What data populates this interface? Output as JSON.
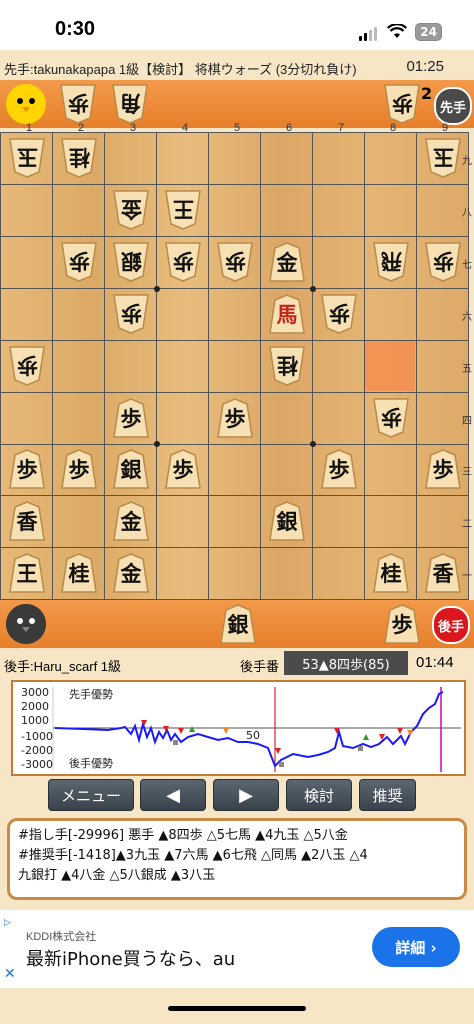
{
  "status": {
    "time": "0:30",
    "battery": "24"
  },
  "header": {
    "text": "先手:takunakapapa 1級【検討】 将棋ウォーズ (3分切れ負け)",
    "clock": "01:25"
  },
  "top_hand": {
    "pieces": [
      "歩",
      "角"
    ],
    "right_piece": "歩",
    "right_count": "2",
    "badge": "先手"
  },
  "bottom_hand": {
    "pieces": [
      "銀",
      "歩"
    ],
    "badge": "後手"
  },
  "board": {
    "col_labels": [
      "1",
      "2",
      "3",
      "4",
      "5",
      "6",
      "7",
      "8",
      "9"
    ],
    "row_labels": [
      "九",
      "八",
      "七",
      "六",
      "五",
      "四",
      "三",
      "二",
      "一"
    ],
    "pieces": [
      {
        "c": 0,
        "r": 0,
        "k": "玉",
        "g": true
      },
      {
        "c": 1,
        "r": 0,
        "k": "桂",
        "g": true
      },
      {
        "c": 8,
        "r": 0,
        "k": "玉",
        "g": true
      },
      {
        "c": 2,
        "r": 1,
        "k": "金",
        "g": true
      },
      {
        "c": 3,
        "r": 1,
        "k": "王",
        "g": true
      },
      {
        "c": 1,
        "r": 2,
        "k": "歩",
        "g": true
      },
      {
        "c": 2,
        "r": 2,
        "k": "銀",
        "g": true
      },
      {
        "c": 3,
        "r": 2,
        "k": "歩",
        "g": true
      },
      {
        "c": 4,
        "r": 2,
        "k": "歩",
        "g": true
      },
      {
        "c": 5,
        "r": 2,
        "k": "金",
        "g": false
      },
      {
        "c": 7,
        "r": 2,
        "k": "飛",
        "g": true
      },
      {
        "c": 8,
        "r": 2,
        "k": "歩",
        "g": true
      },
      {
        "c": 2,
        "r": 3,
        "k": "歩",
        "g": true
      },
      {
        "c": 5,
        "r": 3,
        "k": "馬",
        "g": false,
        "p": true
      },
      {
        "c": 6,
        "r": 3,
        "k": "歩",
        "g": true
      },
      {
        "c": 0,
        "r": 4,
        "k": "歩",
        "g": true
      },
      {
        "c": 5,
        "r": 4,
        "k": "桂",
        "g": true
      },
      {
        "c": 2,
        "r": 5,
        "k": "歩",
        "g": false
      },
      {
        "c": 4,
        "r": 5,
        "k": "歩",
        "g": false
      },
      {
        "c": 7,
        "r": 5,
        "k": "歩",
        "g": true
      },
      {
        "c": 0,
        "r": 6,
        "k": "歩",
        "g": false
      },
      {
        "c": 1,
        "r": 6,
        "k": "歩",
        "g": false
      },
      {
        "c": 2,
        "r": 6,
        "k": "銀",
        "g": false
      },
      {
        "c": 3,
        "r": 6,
        "k": "歩",
        "g": false
      },
      {
        "c": 6,
        "r": 6,
        "k": "歩",
        "g": false
      },
      {
        "c": 8,
        "r": 6,
        "k": "歩",
        "g": false
      },
      {
        "c": 0,
        "r": 7,
        "k": "香",
        "g": false
      },
      {
        "c": 2,
        "r": 7,
        "k": "金",
        "g": false
      },
      {
        "c": 5,
        "r": 7,
        "k": "銀",
        "g": false
      },
      {
        "c": 0,
        "r": 8,
        "k": "王",
        "g": false
      },
      {
        "c": 1,
        "r": 8,
        "k": "桂",
        "g": false
      },
      {
        "c": 2,
        "r": 8,
        "k": "金",
        "g": false
      },
      {
        "c": 7,
        "r": 8,
        "k": "桂",
        "g": false
      },
      {
        "c": 8,
        "r": 8,
        "k": "香",
        "g": false
      }
    ],
    "highlight": {
      "c": 7,
      "r": 4
    }
  },
  "info": {
    "player": "後手:Haru_scarf 1級",
    "turn": "後手番",
    "move": "53▲8四歩(85)",
    "clock": "01:44"
  },
  "graph": {
    "y_labels": [
      "3000",
      "2000",
      "1000",
      "-1000",
      "-2000",
      "-3000"
    ],
    "sente_label": "先手優勢",
    "gote_label": "後手優勢",
    "mid_label": "50"
  },
  "buttons": {
    "menu": "メニュー",
    "prev": "◀",
    "next": "▶",
    "analyze": "検討",
    "recommend": "推奨"
  },
  "comment": {
    "line1": "#指し手[-29996] 悪手 ▲8四歩 △5七馬 ▲4九玉 △5八金",
    "line2": "#推奨手[-1418]▲3九玉 ▲7六馬 ▲6七飛 △同馬 ▲2八玉 △4",
    "line3": "九銀打 ▲4八金 △5八銀成 ▲3八玉"
  },
  "ad": {
    "company": "KDDI株式会社",
    "headline": "最新iPhone買うなら、au",
    "cta": "詳細 ›"
  }
}
